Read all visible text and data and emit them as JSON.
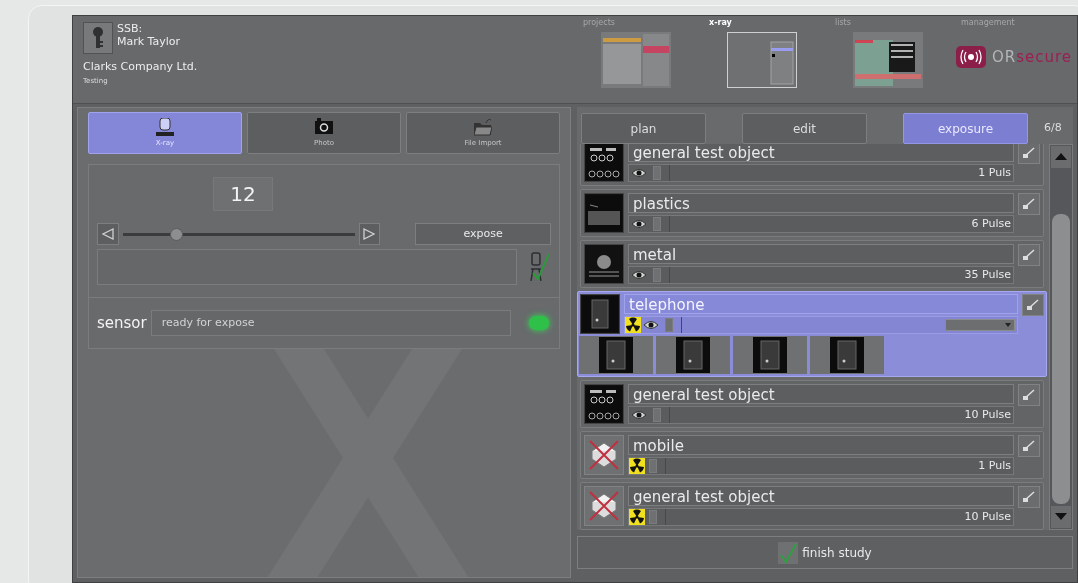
{
  "user": {
    "role": "SSB:",
    "name": "Mark Taylor",
    "company": "Clarks Company Ltd.",
    "context": "Testing"
  },
  "nav": [
    {
      "label": "projects",
      "kind": "projects",
      "selected": false
    },
    {
      "label": "x-ray",
      "kind": "xray",
      "selected": true
    },
    {
      "label": "lists",
      "kind": "lists",
      "selected": false
    },
    {
      "label": "management",
      "kind": "logo",
      "selected": false
    }
  ],
  "logo": {
    "prefix": "OR",
    "suffix": "secure"
  },
  "modes": [
    {
      "label": "X-ray",
      "kind": "xray",
      "selected": true
    },
    {
      "label": "Photo",
      "kind": "camera",
      "selected": false
    },
    {
      "label": "File Import",
      "kind": "folder",
      "selected": false
    }
  ],
  "exposure": {
    "value": "12",
    "slider": {
      "level": 0.23
    },
    "expose_button": "expose",
    "sensor_label": "sensor",
    "sensor_status": "ready for expose",
    "sensor_ready": true
  },
  "steps": [
    {
      "label": "plan",
      "selected": false
    },
    {
      "label": "edit",
      "selected": false
    },
    {
      "label": "exposure",
      "selected": true
    }
  ],
  "step_counter": "6/8",
  "items": [
    {
      "name": "general test object",
      "pulses": "1 Puls",
      "kind": "chart",
      "radiation": false,
      "visible": true,
      "selected": false
    },
    {
      "name": "plastics",
      "pulses": "6 Pulse",
      "kind": "plastic",
      "radiation": false,
      "visible": true,
      "selected": false
    },
    {
      "name": "metal",
      "pulses": "35 Pulse",
      "kind": "metal",
      "radiation": false,
      "visible": true,
      "selected": false
    },
    {
      "name": "telephone",
      "kind": "phone",
      "radiation": true,
      "visible": true,
      "selected": true,
      "images": [
        {
          "kind": "phone"
        },
        {
          "kind": "phone"
        },
        {
          "kind": "phone"
        },
        {
          "kind": "phone"
        }
      ]
    },
    {
      "name": "general test object",
      "pulses": "10 Pulse",
      "kind": "chart",
      "radiation": false,
      "visible": true,
      "selected": false
    },
    {
      "name": "mobile",
      "pulses": "1 Puls",
      "kind": "missing",
      "radiation": true,
      "visible": false,
      "selected": false
    },
    {
      "name": "general test object",
      "pulses": "10 Pulse",
      "kind": "missing",
      "radiation": true,
      "visible": false,
      "selected": false
    }
  ],
  "finish_button": "finish study"
}
